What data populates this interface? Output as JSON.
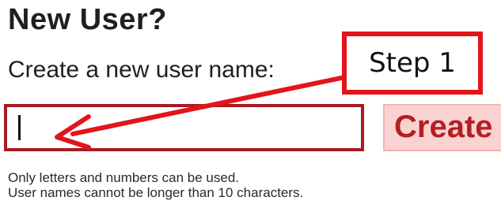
{
  "heading": "New User?",
  "prompt": "Create a new user name:",
  "username_input": {
    "value": ""
  },
  "create_button": {
    "label": "Create"
  },
  "help": {
    "line1": "Only letters and numbers can be used.",
    "line2": "User names cannot be longer than 10 characters."
  },
  "annotation": {
    "step_label": "Step 1",
    "color": "#e3141b"
  },
  "colors": {
    "input_border": "#a51c24",
    "button_bg": "#fbd2d2",
    "button_text": "#b41f23"
  }
}
